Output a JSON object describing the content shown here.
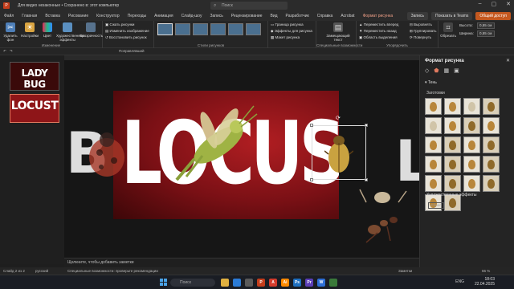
{
  "titlebar": {
    "doc_title": "Для видео незаконные • Сохранено в: этот компьютер",
    "search_placeholder": "Поиск"
  },
  "tabs": [
    "Файл",
    "Главная",
    "Вставка",
    "Рисование",
    "Конструктор",
    "Переходы",
    "Анимация",
    "Слайд-шоу",
    "Запись",
    "Рецензирование",
    "Вид",
    "Разработчик",
    "Справка",
    "Acrobat",
    "Формат рисунка"
  ],
  "tab_buttons": {
    "record": "Запись",
    "teams": "Показать в Teams",
    "share": "Общий доступ"
  },
  "ribbon": {
    "remove_bg": "Удалить фон",
    "corrections": "Настройки",
    "color": "Цвет",
    "artistic": "Художественные эффекты",
    "transparency": "Прозрачность",
    "compress": "Сжать рисунки",
    "change": "Изменить изображение",
    "reset": "Восстановить рисунок",
    "group_adjust": "Изменение",
    "group_styles": "Стили рисунков",
    "border": "Граница рисунка",
    "effects": "Эффекты для рисунка",
    "layout": "Макет рисунка",
    "alt_text": "Замещающий текст",
    "group_access": "Специальные возможности",
    "bring_forward": "Переместить вперед",
    "send_backward": "Переместить назад",
    "selection_pane": "Область выделения",
    "align": "Выровнять",
    "group": "Группировать",
    "rotate": "Повернуть",
    "group_arrange": "Упорядочить",
    "crop": "Обрезать",
    "height_label": "Высота:",
    "height_value": "0,55 см",
    "width_label": "Ширина:",
    "width_value": "0,55 см",
    "group_size": "Размер"
  },
  "toolbar2": {
    "zoom_label": "Поправлявший"
  },
  "thumbnails": [
    {
      "num": "1",
      "text": "LADY BUG"
    },
    {
      "num": "2",
      "text": "LOCUST"
    }
  ],
  "slide": {
    "word": "LOCUST"
  },
  "notes_placeholder": "Щелкните, чтобы добавить заметки",
  "status": {
    "slide": "Слайд 2 из 2",
    "language": "русский",
    "accessibility": "Специальные возможности: проверьте рекомендации",
    "notes": "Заметки",
    "zoom": "66 %"
  },
  "pane": {
    "title": "Формат рисунка",
    "section": "Тень",
    "presets_label": "Заготовки",
    "artistic_label": "Художественные эффекты",
    "reset_label": "Сброс"
  },
  "taskbar": {
    "search": "Поиск",
    "time": "18:03",
    "date": "22.04.2025",
    "lang": "ENG"
  },
  "colors": {
    "accent": "#e07a5f",
    "share_button": "#c4581f",
    "slide_bg": "#9b1a1e"
  }
}
